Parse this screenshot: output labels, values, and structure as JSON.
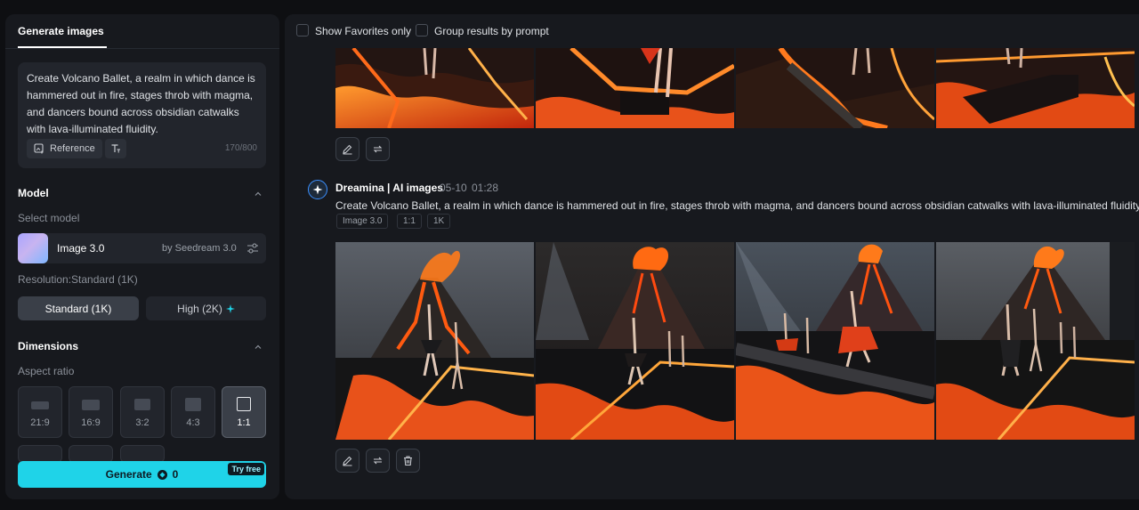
{
  "left_panel": {
    "tab": "Generate images",
    "prompt": {
      "text": "Create Volcano Ballet, a realm in which dance is hammered out in fire, stages throb with magma, and dancers bound across obsidian catwalks with lava-illuminated fluidity.",
      "reference_label": "Reference",
      "char_count": "170/800"
    },
    "model": {
      "section_title": "Model",
      "select_label": "Select model",
      "name": "Image 3.0",
      "by": "by Seedream 3.0"
    },
    "resolution": {
      "label": "Resolution:Standard (1K)",
      "standard": "Standard (1K)",
      "high": "High (2K)"
    },
    "dimensions": {
      "section_title": "Dimensions",
      "aspect_label": "Aspect ratio",
      "ratios": [
        "21:9",
        "16:9",
        "3:2",
        "4:3",
        "1:1"
      ],
      "selected": "1:1"
    },
    "generate": {
      "label": "Generate",
      "credits": "0",
      "badge": "Try free"
    }
  },
  "main": {
    "filters": {
      "favorites": "Show Favorites only",
      "group": "Group results by prompt"
    },
    "generation": {
      "author": "Dreamina | AI images",
      "date": "05-10",
      "time": "01:28",
      "prompt": "Create Volcano Ballet, a realm in which dance is hammered out in fire, stages throb with magma, and dancers bound across obsidian catwalks with lava-illuminated fluidity.",
      "tags": [
        "Image 3.0",
        "1:1",
        "1K"
      ]
    }
  },
  "colors": {
    "accent": "#1fd3e8",
    "panel": "#17191e",
    "background": "#0e0f12"
  }
}
